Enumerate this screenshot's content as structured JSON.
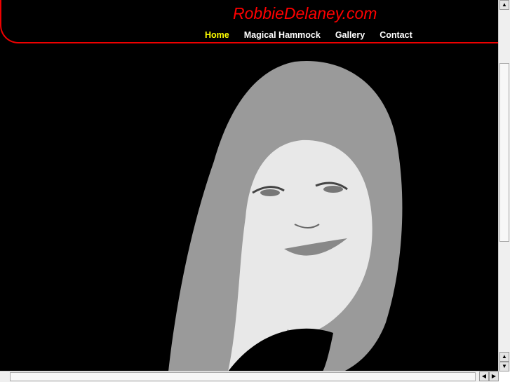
{
  "site_title": "RobbieDelaney.com",
  "nav": [
    {
      "label": "Home",
      "active": true
    },
    {
      "label": "Magical Hammock",
      "active": false
    },
    {
      "label": "Gallery",
      "active": false
    },
    {
      "label": "Contact",
      "active": false
    }
  ],
  "colors": {
    "accent": "#ff0000",
    "active_nav": "#ffff00",
    "background": "#000000"
  },
  "scrollbar_icons": {
    "up": "▲",
    "down": "▼",
    "left": "◀",
    "right": "▶"
  }
}
